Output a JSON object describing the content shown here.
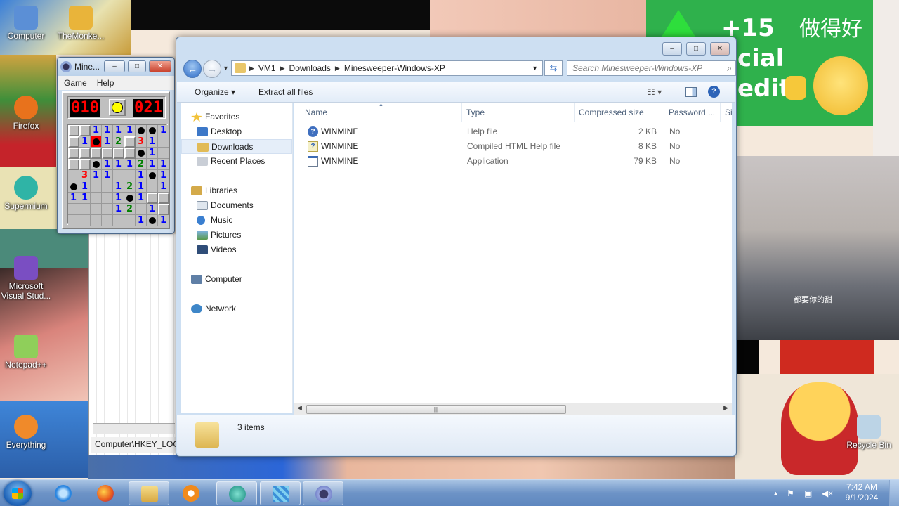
{
  "desktop": {
    "icons": [
      {
        "label": "Computer",
        "icon": "computer-icon",
        "color": "#5b8fd6"
      },
      {
        "label": "TheMonke...",
        "icon": "monkey-game-icon",
        "color": "#e9b43a"
      },
      {
        "label": "Firefox",
        "icon": "firefox-icon",
        "color": "#e8721c"
      },
      {
        "label": "Supermium",
        "icon": "supermium-icon",
        "color": "#2fb4a6"
      },
      {
        "label": "Microsoft Visual Stud...",
        "icon": "visual-studio-icon",
        "color": "#7a4ec2"
      },
      {
        "label": "Notepad++",
        "icon": "notepadpp-icon",
        "color": "#8fcf5a"
      },
      {
        "label": "Everything",
        "icon": "everything-search-icon",
        "color": "#f08a2a"
      },
      {
        "label": "Recycle Bin",
        "icon": "recycle-bin-icon",
        "color": "#bcd4e6"
      }
    ],
    "promo": {
      "plus": "+15",
      "line1": "cial",
      "line2": "edit",
      "chinese": "做得好"
    },
    "video_subtitle": "都要你的甜"
  },
  "minesweeper": {
    "title": "Mine...",
    "menu": [
      "Game",
      "Help"
    ],
    "mines_left": "010",
    "timer": "021",
    "board": [
      "UU1111MM1",
      "U1X12U31O",
      "UUUUUUM1O",
      "UUM111211",
      "O311OO1M1",
      "M1OO121O1",
      "11OO1M1UU",
      "OOOO12O1U",
      "OOOOOO1M1"
    ]
  },
  "registry": {
    "path": "Computer\\HKEY_LOCAL_MACHINE"
  },
  "explorer": {
    "window_buttons": {
      "minimize": "–",
      "maximize": "□",
      "close": "✕"
    },
    "breadcrumb": [
      "VM1",
      "Downloads",
      "Minesweeper-Windows-XP"
    ],
    "search_placeholder": "Search Minesweeper-Windows-XP",
    "toolbar": {
      "organize": "Organize ▾",
      "extract": "Extract all files",
      "help": "?"
    },
    "nav": {
      "favorites": "Favorites",
      "favorite_items": [
        "Desktop",
        "Downloads",
        "Recent Places"
      ],
      "libraries": "Libraries",
      "library_items": [
        "Documents",
        "Music",
        "Pictures",
        "Videos"
      ],
      "computer": "Computer",
      "network": "Network"
    },
    "columns": [
      "Name",
      "Type",
      "Compressed size",
      "Password ...",
      "Si"
    ],
    "files": [
      {
        "name": "WINMINE",
        "type": "Help file",
        "size": "2 KB",
        "password": "No",
        "icon": "help-file-icon"
      },
      {
        "name": "WINMINE",
        "type": "Compiled HTML Help file",
        "size": "8 KB",
        "password": "No",
        "icon": "chm-file-icon"
      },
      {
        "name": "WINMINE",
        "type": "Application",
        "size": "79 KB",
        "password": "No",
        "icon": "application-icon"
      }
    ],
    "status": "3 items"
  },
  "taskbar": {
    "apps": [
      "internet-explorer-icon",
      "firefox-icon",
      "explorer-icon",
      "media-player-icon",
      "supermium-icon",
      "regedit-icon",
      "minesweeper-icon"
    ],
    "time": "7:42 AM",
    "date": "9/1/2024"
  }
}
